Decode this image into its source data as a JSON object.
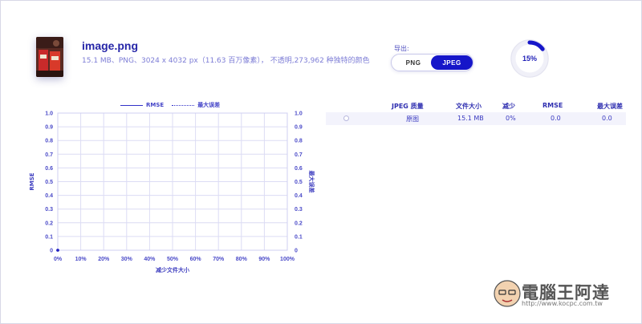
{
  "file": {
    "name": "image.png",
    "details": "15.1 MB、PNG、3024 x 4032 px（11.63 百万像素）， 不透明,273,962 种独特的颜色"
  },
  "export": {
    "label": "导出:",
    "options": [
      "PNG",
      "JPEG"
    ],
    "selected": "JPEG"
  },
  "progress": {
    "value": 15,
    "label": "15%"
  },
  "legend": {
    "series1": "RMSE",
    "series2": "最大误差"
  },
  "chart_data": {
    "type": "line",
    "x_ticks": [
      "0%",
      "10%",
      "20%",
      "30%",
      "40%",
      "50%",
      "60%",
      "70%",
      "80%",
      "90%",
      "100%"
    ],
    "y_ticks": [
      "0",
      "0.1",
      "0.2",
      "0.3",
      "0.4",
      "0.5",
      "0.6",
      "0.7",
      "0.8",
      "0.9",
      "1.0"
    ],
    "xlabel": "减少文件大小",
    "ylabel": "RMSE",
    "y2label": "最大误差",
    "xlim": [
      0,
      100
    ],
    "ylim": [
      0,
      1.0
    ],
    "grid": true,
    "series": [
      {
        "name": "RMSE",
        "x": [
          0
        ],
        "y": [
          0
        ]
      },
      {
        "name": "最大误差",
        "x": [
          0
        ],
        "y": [
          0
        ]
      }
    ]
  },
  "table": {
    "headers": [
      "JPEG 质量",
      "文件大小",
      "减少",
      "RMSE",
      "最大误差"
    ],
    "rows": [
      {
        "quality": "原图",
        "size": "15.1 MB",
        "reduction": "0%",
        "rmse": "0.0",
        "max_error": "0.0"
      }
    ]
  },
  "watermark": {
    "title": "電腦王阿達",
    "url": "http://www.kocpc.com.tw"
  },
  "colors": {
    "accent": "#1616c9",
    "text": "#3a39c9",
    "grid": "#dcdcf4"
  }
}
